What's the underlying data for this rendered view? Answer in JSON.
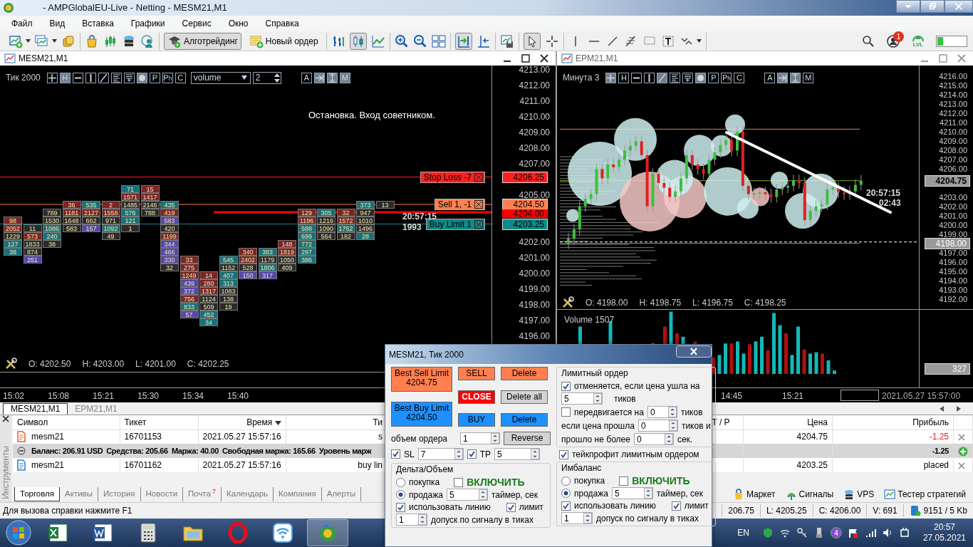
{
  "window": {
    "title": "- AMPGlobalEU-Live - Netting - MESM21,M1"
  },
  "menu": [
    "Файл",
    "Вид",
    "Вставка",
    "Графики",
    "Сервис",
    "Окно",
    "Справка"
  ],
  "toolbar": [
    [
      {
        "kind": "new-chart",
        "pressed": false,
        "caret": true
      },
      {
        "kind": "profiles",
        "pressed": false,
        "caret": true
      },
      {
        "kind": "wallet",
        "pressed": false
      }
    ],
    [
      {
        "kind": "shop",
        "pressed": false
      },
      {
        "kind": "signals",
        "pressed": false
      },
      {
        "kind": "vps",
        "pressed": false
      },
      {
        "kind": "connect",
        "pressed": false
      }
    ],
    [
      {
        "kind": "algo",
        "label": "Алготрейдинг",
        "pressed": true
      },
      {
        "kind": "order",
        "label": "Новый ордер",
        "pressed": false
      }
    ],
    [
      {
        "kind": "bars",
        "pressed": false
      },
      {
        "kind": "candles",
        "pressed": true
      },
      {
        "kind": "line",
        "pressed": false
      }
    ],
    [
      {
        "kind": "zoom-in",
        "pressed": false
      },
      {
        "kind": "zoom-out",
        "pressed": false
      },
      {
        "kind": "tile",
        "pressed": false
      }
    ],
    [
      {
        "kind": "autoscroll",
        "pressed": true
      },
      {
        "kind": "shift",
        "pressed": false
      }
    ],
    [
      {
        "kind": "templates",
        "pressed": false
      }
    ],
    [
      {
        "kind": "cursor",
        "pressed": true
      },
      {
        "kind": "crosshair",
        "pressed": false
      }
    ],
    [
      {
        "kind": "vline",
        "pressed": false
      },
      {
        "kind": "hline",
        "pressed": false
      },
      {
        "kind": "trend",
        "pressed": false
      },
      {
        "kind": "fibo",
        "pressed": false
      },
      {
        "kind": "frame",
        "pressed": false
      },
      {
        "kind": "text",
        "pressed": false
      },
      {
        "kind": "arrows",
        "pressed": false,
        "caret": true
      }
    ]
  ],
  "toolbar_right": {
    "notifications": "1",
    "level_label": "LVL"
  },
  "left_chart": {
    "title": "MESM21,M1",
    "timeframe": "Тик  2000",
    "tools": [
      {
        "kind": "plus",
        "on": false
      },
      {
        "kind": "letter",
        "label": "H",
        "on": true
      },
      {
        "kind": "dash",
        "on": false
      },
      {
        "kind": "vbar",
        "on": false
      },
      {
        "kind": "slash",
        "on": false
      },
      {
        "kind": "lines",
        "on": false
      },
      {
        "kind": "lines-t",
        "on": false
      },
      {
        "kind": "dot",
        "on": true
      },
      {
        "kind": "letter",
        "label": "P",
        "on": false
      },
      {
        "kind": "letter",
        "label": "P$_{h}$",
        "on": false
      },
      {
        "kind": "letter",
        "label": "C",
        "on": false
      }
    ],
    "indicator": "volume",
    "period": "2",
    "tools2": [
      {
        "kind": "letter",
        "label": "A",
        "on": false
      },
      {
        "kind": "arrow",
        "on": true
      },
      {
        "kind": "ibeam",
        "on": true
      },
      {
        "kind": "letter",
        "label": "M",
        "on": true
      }
    ],
    "message": "Остановка. Вход советником.",
    "price_ticks": [
      "4213.00",
      "4212.00",
      "4211.00",
      "4210.00",
      "4209.00",
      "4208.00",
      "4207.00",
      "4205.00",
      "4202.00",
      "4201.00",
      "4200.00",
      "4199.00",
      "4198.00",
      "4197.00",
      "4196.00"
    ],
    "orders": [
      {
        "label": "Stop Loss  -7",
        "price": "4206.25",
        "color": "#ff2020"
      },
      {
        "label": "Sell  1,  -1",
        "price": "4204.50",
        "color": "#ff7f50"
      },
      {
        "label": "Buy Limit  1",
        "price": "4203.25",
        "color": "#0f8a86"
      }
    ],
    "bid": {
      "price": "4204.00",
      "color": "#ff0000"
    },
    "timer": "20:57:15",
    "ticks_count": "1993",
    "footprint": [
      {
        "cells": [
          {
            "text": "98",
            "color": "#7a2626"
          },
          {
            "text": "2052",
            "color": "#7a2626"
          },
          {
            "text": "1229",
            "color": "#2b2b2b"
          },
          {
            "text": "127",
            "color": "#17707a"
          },
          {
            "text": "38",
            "color": "#17707a"
          }
        ]
      },
      {
        "cells": [
          {
            "text": "11",
            "color": "#2b2b2b"
          },
          {
            "text": "573",
            "color": "#7a2626"
          },
          {
            "text": "1833",
            "color": "#2b2b2b"
          },
          {
            "text": "874",
            "color": "#2b2b2b"
          },
          {
            "text": "251",
            "color": "#5546b0"
          }
        ]
      },
      {
        "cells": [
          {
            "text": "789",
            "color": "#2b2b2b"
          },
          {
            "text": "1530",
            "color": "#2b2b2b"
          },
          {
            "text": "1086",
            "color": "#17707a"
          },
          {
            "text": "240",
            "color": "#17707a"
          },
          {
            "text": "38",
            "color": "#2b2b2b"
          }
        ]
      },
      {
        "cells": [
          {
            "text": "36",
            "color": "#7a2626"
          },
          {
            "text": "1181",
            "color": "#7a2626"
          },
          {
            "text": "1648",
            "color": "#2b2b2b"
          },
          {
            "text": "583",
            "color": "#2b2b2b"
          }
        ]
      },
      {
        "cells": [
          {
            "text": "535",
            "color": "#17707a"
          },
          {
            "text": "2127",
            "color": "#7a2626"
          },
          {
            "text": "662",
            "color": "#2b2b2b"
          },
          {
            "text": "157",
            "color": "#5546b0"
          }
        ]
      },
      {
        "cells": [
          {
            "text": "2",
            "color": "#7a2626"
          },
          {
            "text": "1558",
            "color": "#7a2626"
          },
          {
            "text": "971",
            "color": "#2b2b2b"
          },
          {
            "text": "1092",
            "color": "#17707a"
          },
          {
            "text": "49",
            "color": "#2b2b2b"
          }
        ]
      },
      {
        "cells": [
          {
            "text": "71",
            "color": "#17707a"
          },
          {
            "text": "1571",
            "color": "#7a2626"
          },
          {
            "text": "1485",
            "color": "#2b2b2b"
          },
          {
            "text": "576",
            "color": "#17707a"
          },
          {
            "text": "121",
            "color": "#17707a"
          },
          {
            "text": "1",
            "color": "#2b2b2b"
          }
        ]
      },
      {
        "cells": [
          {
            "text": "15",
            "color": "#7a2626"
          },
          {
            "text": "1417",
            "color": "#7a2626"
          },
          {
            "text": "2146",
            "color": "#2b2b2b"
          },
          {
            "text": "788",
            "color": "#2b2b2b"
          }
        ]
      },
      {
        "cells": [
          {
            "text": "435",
            "color": "#17707a"
          },
          {
            "text": "419",
            "color": "#7a2626"
          },
          {
            "text": "583",
            "color": "#5546b0"
          },
          {
            "text": "420",
            "color": "#2b2b2b"
          },
          {
            "text": "1199",
            "color": "#7a2626"
          },
          {
            "text": "344",
            "color": "#5546b0"
          },
          {
            "text": "466",
            "color": "#5546b0"
          },
          {
            "text": "330",
            "color": "#5546b0"
          },
          {
            "text": "32",
            "color": "#2b2b2b"
          }
        ]
      },
      {
        "cells": [
          {
            "text": "33",
            "color": "#7a2626"
          },
          {
            "text": "275",
            "color": "#7a2626"
          },
          {
            "text": "1249",
            "color": "#7a2626"
          },
          {
            "text": "439",
            "color": "#5546b0"
          },
          {
            "text": "372",
            "color": "#5546b0"
          },
          {
            "text": "756",
            "color": "#7a2626"
          },
          {
            "text": "833",
            "color": "#17707a"
          },
          {
            "text": "57",
            "color": "#5546b0"
          }
        ]
      },
      {
        "cells": [
          {
            "text": "14",
            "color": "#7a2626"
          },
          {
            "text": "280",
            "color": "#7a2626"
          },
          {
            "text": "1317",
            "color": "#7a2626"
          },
          {
            "text": "1124",
            "color": "#2b2b2b"
          },
          {
            "text": "509",
            "color": "#2b2b2b"
          },
          {
            "text": "452",
            "color": "#17707a"
          },
          {
            "text": "34",
            "color": "#17707a"
          }
        ]
      },
      {
        "cells": [
          {
            "text": "545",
            "color": "#17707a"
          },
          {
            "text": "1152",
            "color": "#2b2b2b"
          },
          {
            "text": "407",
            "color": "#17707a"
          },
          {
            "text": "313",
            "color": "#17707a"
          },
          {
            "text": "1083",
            "color": "#2b2b2b"
          },
          {
            "text": "138",
            "color": "#2b2b2b"
          },
          {
            "text": "19",
            "color": "#2b2b2b"
          }
        ]
      },
      {
        "cells": [
          {
            "text": "340",
            "color": "#7a2626"
          },
          {
            "text": "2402",
            "color": "#7a2626"
          },
          {
            "text": "528",
            "color": "#2b2b2b"
          },
          {
            "text": "150",
            "color": "#5546b0"
          }
        ]
      },
      {
        "cells": [
          {
            "text": "383",
            "color": "#17707a"
          },
          {
            "text": "1179",
            "color": "#2b2b2b"
          },
          {
            "text": "1806",
            "color": "#17707a"
          },
          {
            "text": "317",
            "color": "#5546b0"
          }
        ]
      },
      {
        "cells": [
          {
            "text": "148",
            "color": "#7a2626"
          },
          {
            "text": "1819",
            "color": "#7a2626"
          },
          {
            "text": "1050",
            "color": "#2b2b2b"
          },
          {
            "text": "409",
            "color": "#2b2b2b"
          }
        ]
      },
      {
        "cells": [
          {
            "text": "129",
            "color": "#7a2626"
          },
          {
            "text": "1196",
            "color": "#7a2626"
          },
          {
            "text": "588",
            "color": "#17707a"
          },
          {
            "text": "699",
            "color": "#17707a"
          },
          {
            "text": "772",
            "color": "#17707a"
          },
          {
            "text": "297",
            "color": "#17707a"
          },
          {
            "text": "386",
            "color": "#17707a"
          }
        ]
      },
      {
        "cells": [
          {
            "text": "305",
            "color": "#17707a"
          },
          {
            "text": "1216",
            "color": "#2b2b2b"
          },
          {
            "text": "1090",
            "color": "#2b2b2b"
          },
          {
            "text": "564",
            "color": "#2b2b2b"
          }
        ]
      },
      {
        "cells": [
          {
            "text": "32",
            "color": "#7a2626"
          },
          {
            "text": "1572",
            "color": "#7a2626"
          },
          {
            "text": "1752",
            "color": "#17707a"
          },
          {
            "text": "182",
            "color": "#2b2b2b"
          }
        ]
      },
      {
        "cells": [
          {
            "text": "373",
            "color": "#17707a"
          },
          {
            "text": "947",
            "color": "#2b2b2b"
          },
          {
            "text": "1010",
            "color": "#2b2b2b"
          },
          {
            "text": "1496",
            "color": "#2b2b2b"
          },
          {
            "text": "28",
            "color": "#17707a"
          }
        ]
      },
      {
        "cells": [
          {
            "text": "13",
            "color": "#2b2b2b"
          }
        ]
      }
    ],
    "ohlc": [
      "O: 4202.50",
      "H: 4203.00",
      "L: 4201.00",
      "C: 4202.25"
    ],
    "time_ticks": [
      "15:02",
      "15:08",
      "15:21",
      "15:30",
      "15:34",
      "15:40"
    ]
  },
  "right_chart": {
    "title": "EPM21,M1",
    "timeframe": "Минута  3",
    "tools": [
      {
        "kind": "plus",
        "on": true
      },
      {
        "kind": "letter",
        "label": "H",
        "on": false
      },
      {
        "kind": "dash",
        "on": false
      },
      {
        "kind": "vbar",
        "on": false
      },
      {
        "kind": "slash",
        "on": true
      },
      {
        "kind": "lines",
        "on": false
      },
      {
        "kind": "lines-t",
        "on": false
      },
      {
        "kind": "dot",
        "on": true
      },
      {
        "kind": "letter",
        "label": "P",
        "on": false
      },
      {
        "kind": "letter",
        "label": "P$_{h}$",
        "on": false
      },
      {
        "kind": "letter",
        "label": "C",
        "on": false
      }
    ],
    "tools2": [
      {
        "kind": "letter",
        "label": "A",
        "on": false
      },
      {
        "kind": "arrow",
        "on": true
      },
      {
        "kind": "ibeam",
        "on": true
      },
      {
        "kind": "letter",
        "label": "M",
        "on": false
      }
    ],
    "price_ticks": [
      "4216.00",
      "4215.00",
      "4214.00",
      "4213.00",
      "4212.00",
      "4211.00",
      "4210.00",
      "4209.00",
      "4208.00",
      "4207.00",
      "4206.00",
      "4203.00",
      "4202.00",
      "4201.00",
      "4200.00",
      "4199.00",
      "4197.00",
      "4196.00",
      "4195.00",
      "4194.00",
      "4193.00",
      "4192.00"
    ],
    "last_price": "4204.75",
    "cursor_price": "4198.00",
    "timer": "20:57:15",
    "countdown": "02:43",
    "ohlc": [
      "O: 4198.00",
      "H: 4198.75",
      "L: 4196.75",
      "C: 4198.25"
    ],
    "volume_label": "Volume 1507",
    "volume_value": "327",
    "time_ticks": [
      "14:45",
      "15:21"
    ],
    "time_cursor": "2021.05.27 15:57:00"
  },
  "chart_tabs": [
    {
      "label": "MESM21,M1",
      "selected": true
    },
    {
      "label": "EPM21,M1",
      "selected": false
    }
  ],
  "terminal": {
    "side_label": "Инструменты",
    "columns": [
      "Символ",
      "Тикет",
      "Время",
      "Ти",
      "T / P",
      "Цена",
      "Прибыль"
    ],
    "rows": [
      {
        "kind": "order",
        "symbol": "mesm21",
        "ticket": "16701153",
        "time": "2021.05.27 15:57:16",
        "type": "s",
        "price": "4204.75",
        "profit": "-1.25",
        "loss": true
      },
      {
        "kind": "balance",
        "items": [
          "Баланс: 206.91 USD",
          "Средства: 205.66",
          "Маржа: 40.00",
          "Свободная маржа: 165.66",
          "Уровень марж"
        ],
        "profit": "-1.25"
      },
      {
        "kind": "order",
        "symbol": "mesm21",
        "ticket": "16701162",
        "time": "2021.05.27 15:57:16",
        "type": "buy lin",
        "price": "4203.25",
        "profit": "placed",
        "loss": false
      }
    ],
    "tabs": [
      {
        "label": "Торговля",
        "selected": true
      },
      {
        "label": "Активы",
        "selected": false
      },
      {
        "label": "История",
        "selected": false
      },
      {
        "label": "Новости",
        "selected": false
      },
      {
        "label": "Почта",
        "selected": false,
        "badge": "7"
      },
      {
        "label": "Календарь",
        "selected": false
      },
      {
        "label": "Компания",
        "selected": false
      },
      {
        "label": "Алерты",
        "selected": false
      }
    ],
    "links": [
      {
        "kind": "market",
        "label": "Маркет"
      },
      {
        "kind": "signals",
        "label": "Сигналы"
      },
      {
        "kind": "vps",
        "label": "VPS"
      },
      {
        "kind": "tester",
        "label": "Тестер стратегий"
      }
    ]
  },
  "status_bar": {
    "help": "Для вызова справки нажмите F1",
    "cells": [
      "206.75",
      "L: 4205.25",
      "C: 4206.00",
      "V: 691"
    ],
    "traffic": "9151 / 5 Kb"
  },
  "taskbar": {
    "apps": [
      {
        "kind": "sheet",
        "active": false
      },
      {
        "kind": "doc",
        "active": false
      },
      {
        "kind": "calc",
        "active": false
      },
      {
        "kind": "folder",
        "active": false
      },
      {
        "kind": "ring",
        "active": false
      },
      {
        "kind": "wifi",
        "active": false
      },
      {
        "kind": "terminal",
        "active": true
      }
    ],
    "language": "EN",
    "tray_badge": "4",
    "time": "20:57",
    "date": "27.05.2021"
  },
  "dialog": {
    "title": "MESM21, Тик  2000",
    "buttons": [
      {
        "kind": "limit",
        "label": "Best Sell Limit",
        "price": "4204.75",
        "color": "#ff7f50"
      },
      {
        "kind": "limit",
        "label": "Best Buy Limit",
        "price": "4204.50",
        "color": "#1e90ff"
      },
      {
        "kind": "market",
        "label": "SELL",
        "color": "#ff7f50"
      },
      {
        "kind": "market",
        "label": "CLOSE",
        "color": "#ff0000",
        "bold": true
      },
      {
        "kind": "market",
        "label": "BUY",
        "color": "#1e90ff"
      },
      {
        "kind": "cancel",
        "label": "Delete",
        "color": "#ff7f50"
      },
      {
        "kind": "cancel",
        "label": "Delete all",
        "color": "#d3d3d3"
      },
      {
        "kind": "cancel",
        "label": "Delete",
        "color": "#1e90ff"
      }
    ],
    "volume": {
      "label": "объем ордера",
      "value": "1"
    },
    "reverse": "Reverse",
    "stops": [
      {
        "label": "SL",
        "checked": true,
        "value": "7"
      },
      {
        "label": "TP",
        "checked": true,
        "value": "5"
      }
    ],
    "limit_group": {
      "title": "Лимитный ордер",
      "cancel": {
        "checked": true,
        "label": "отменяется, если цена ушла на",
        "value": "5",
        "unit": "тиков"
      },
      "move": {
        "checked": false,
        "label": "передвигается на",
        "value": "0",
        "unit": "тиков"
      },
      "rows": [
        {
          "label": "если цена прошла",
          "value": "0",
          "unit": "тиков и"
        },
        {
          "label": "прошло не более",
          "value": "0",
          "unit": "сек."
        }
      ]
    },
    "tp_limit": {
      "checked": true,
      "label": "тейкпрофит лимитным ордером"
    },
    "signal_groups": [
      {
        "title": "Дельта/Объем",
        "options": [
          {
            "label": "покупка",
            "selected": false
          },
          {
            "label": "продажа",
            "selected": true
          }
        ],
        "enable": {
          "label": "ВКЛЮЧИТЬ",
          "checked": false
        },
        "timer": {
          "value": "5",
          "label": "таймер, сек"
        },
        "use_line": {
          "label": "использовать линию",
          "checked": true
        },
        "limit": {
          "label": "лимит",
          "checked": true
        },
        "tolerance": {
          "value": "1",
          "label": "допуск по сигналу в тиках"
        }
      },
      {
        "title": "Имбаланс",
        "options": [
          {
            "label": "покупка",
            "selected": false
          },
          {
            "label": "продажа",
            "selected": true
          }
        ],
        "enable": {
          "label": "ВКЛЮЧИТЬ",
          "checked": false
        },
        "timer": {
          "value": "5",
          "label": "таймер, сек"
        },
        "use_line": {
          "label": "использовать линию",
          "checked": true
        },
        "limit": {
          "label": "лимит",
          "checked": true
        },
        "tolerance": {
          "value": "1",
          "label": "допуск по сигналу в тиках"
        }
      }
    ]
  }
}
